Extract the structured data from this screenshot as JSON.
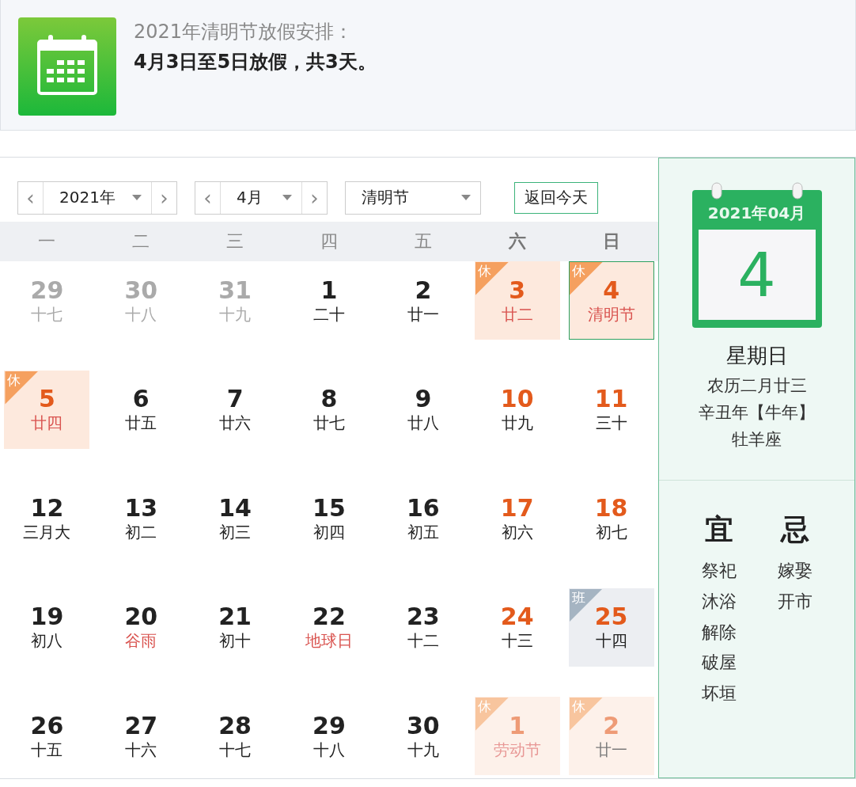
{
  "notice": {
    "title": "2021年清明节放假安排：",
    "text": "4月3日至5日放假，共3天。"
  },
  "controls": {
    "year": {
      "prev": "‹",
      "value": "2021年",
      "next": "›"
    },
    "month": {
      "prev": "‹",
      "value": "4月",
      "next": "›"
    },
    "holiday": {
      "value": "清明节"
    },
    "today_button": "返回今天"
  },
  "weekdays": [
    {
      "label": "一",
      "weekend": false
    },
    {
      "label": "二",
      "weekend": false
    },
    {
      "label": "三",
      "weekend": false
    },
    {
      "label": "四",
      "weekend": false
    },
    {
      "label": "五",
      "weekend": false
    },
    {
      "label": "六",
      "weekend": true
    },
    {
      "label": "日",
      "weekend": true
    }
  ],
  "days": [
    {
      "day": "29",
      "lunar": "十七",
      "kind": "normal",
      "outside": true,
      "weekend": false,
      "festival": false,
      "selected": false
    },
    {
      "day": "30",
      "lunar": "十八",
      "kind": "normal",
      "outside": true,
      "weekend": false,
      "festival": false,
      "selected": false
    },
    {
      "day": "31",
      "lunar": "十九",
      "kind": "normal",
      "outside": true,
      "weekend": false,
      "festival": false,
      "selected": false
    },
    {
      "day": "1",
      "lunar": "二十",
      "kind": "normal",
      "outside": false,
      "weekend": false,
      "festival": false,
      "selected": false
    },
    {
      "day": "2",
      "lunar": "廿一",
      "kind": "normal",
      "outside": false,
      "weekend": false,
      "festival": false,
      "selected": false
    },
    {
      "day": "3",
      "lunar": "廿二",
      "kind": "holiday",
      "badge": "休",
      "outside": false,
      "weekend": true,
      "festival": true,
      "selected": false
    },
    {
      "day": "4",
      "lunar": "清明节",
      "kind": "holiday",
      "badge": "休",
      "outside": false,
      "weekend": true,
      "festival": true,
      "selected": true
    },
    {
      "day": "5",
      "lunar": "廿四",
      "kind": "holiday",
      "badge": "休",
      "outside": false,
      "weekend": false,
      "festival": true,
      "selected": false
    },
    {
      "day": "6",
      "lunar": "廿五",
      "kind": "normal",
      "outside": false,
      "weekend": false,
      "festival": false,
      "selected": false
    },
    {
      "day": "7",
      "lunar": "廿六",
      "kind": "normal",
      "outside": false,
      "weekend": false,
      "festival": false,
      "selected": false
    },
    {
      "day": "8",
      "lunar": "廿七",
      "kind": "normal",
      "outside": false,
      "weekend": false,
      "festival": false,
      "selected": false
    },
    {
      "day": "9",
      "lunar": "廿八",
      "kind": "normal",
      "outside": false,
      "weekend": false,
      "festival": false,
      "selected": false
    },
    {
      "day": "10",
      "lunar": "廿九",
      "kind": "normal",
      "outside": false,
      "weekend": true,
      "festival": false,
      "selected": false
    },
    {
      "day": "11",
      "lunar": "三十",
      "kind": "normal",
      "outside": false,
      "weekend": true,
      "festival": false,
      "selected": false
    },
    {
      "day": "12",
      "lunar": "三月大",
      "kind": "normal",
      "outside": false,
      "weekend": false,
      "festival": false,
      "selected": false
    },
    {
      "day": "13",
      "lunar": "初二",
      "kind": "normal",
      "outside": false,
      "weekend": false,
      "festival": false,
      "selected": false
    },
    {
      "day": "14",
      "lunar": "初三",
      "kind": "normal",
      "outside": false,
      "weekend": false,
      "festival": false,
      "selected": false
    },
    {
      "day": "15",
      "lunar": "初四",
      "kind": "normal",
      "outside": false,
      "weekend": false,
      "festival": false,
      "selected": false
    },
    {
      "day": "16",
      "lunar": "初五",
      "kind": "normal",
      "outside": false,
      "weekend": false,
      "festival": false,
      "selected": false
    },
    {
      "day": "17",
      "lunar": "初六",
      "kind": "normal",
      "outside": false,
      "weekend": true,
      "festival": false,
      "selected": false
    },
    {
      "day": "18",
      "lunar": "初七",
      "kind": "normal",
      "outside": false,
      "weekend": true,
      "festival": false,
      "selected": false
    },
    {
      "day": "19",
      "lunar": "初八",
      "kind": "normal",
      "outside": false,
      "weekend": false,
      "festival": false,
      "selected": false
    },
    {
      "day": "20",
      "lunar": "谷雨",
      "kind": "normal",
      "outside": false,
      "weekend": false,
      "festival": true,
      "selected": false
    },
    {
      "day": "21",
      "lunar": "初十",
      "kind": "normal",
      "outside": false,
      "weekend": false,
      "festival": false,
      "selected": false
    },
    {
      "day": "22",
      "lunar": "地球日",
      "kind": "normal",
      "outside": false,
      "weekend": false,
      "festival": true,
      "selected": false
    },
    {
      "day": "23",
      "lunar": "十二",
      "kind": "normal",
      "outside": false,
      "weekend": false,
      "festival": false,
      "selected": false
    },
    {
      "day": "24",
      "lunar": "十三",
      "kind": "normal",
      "outside": false,
      "weekend": true,
      "festival": false,
      "selected": false
    },
    {
      "day": "25",
      "lunar": "十四",
      "kind": "workday",
      "badge": "班",
      "outside": false,
      "weekend": true,
      "festival": false,
      "selected": false
    },
    {
      "day": "26",
      "lunar": "十五",
      "kind": "normal",
      "outside": false,
      "weekend": false,
      "festival": false,
      "selected": false
    },
    {
      "day": "27",
      "lunar": "十六",
      "kind": "normal",
      "outside": false,
      "weekend": false,
      "festival": false,
      "selected": false
    },
    {
      "day": "28",
      "lunar": "十七",
      "kind": "normal",
      "outside": false,
      "weekend": false,
      "festival": false,
      "selected": false
    },
    {
      "day": "29",
      "lunar": "十八",
      "kind": "normal",
      "outside": false,
      "weekend": false,
      "festival": false,
      "selected": false
    },
    {
      "day": "30",
      "lunar": "十九",
      "kind": "normal",
      "outside": false,
      "weekend": false,
      "festival": false,
      "selected": false
    },
    {
      "day": "1",
      "lunar": "劳动节",
      "kind": "holiday",
      "badge": "休",
      "outside": true,
      "weekend": true,
      "festival": true,
      "selected": false
    },
    {
      "day": "2",
      "lunar": "廿一",
      "kind": "holiday",
      "badge": "休",
      "outside": true,
      "weekend": true,
      "festival": false,
      "selected": false
    }
  ],
  "detail": {
    "month": "2021年04月",
    "day": "4",
    "weekday": "星期日",
    "lunar": "农历二月廿三",
    "year": "辛丑年【牛年】",
    "zodiac": "牡羊座",
    "good": {
      "title": "宜",
      "items": [
        "祭祀",
        "沐浴",
        "解除",
        "破屋",
        "坏垣"
      ]
    },
    "bad": {
      "title": "忌",
      "items": [
        "嫁娶",
        "开市"
      ]
    }
  }
}
